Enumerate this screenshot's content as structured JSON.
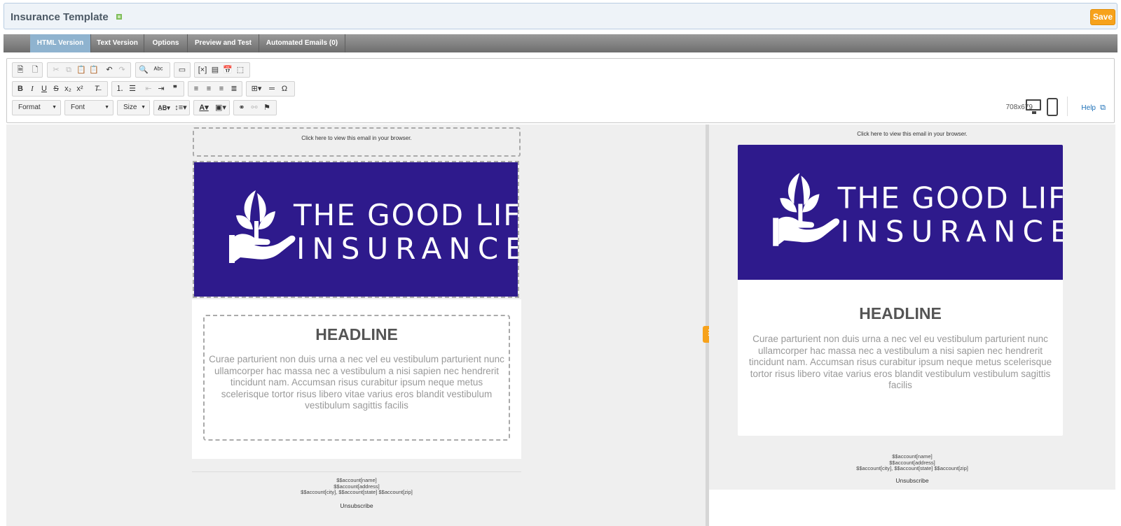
{
  "header": {
    "title": "Insurance Template",
    "save_label": "Save"
  },
  "tabs": [
    {
      "label": "HTML Version",
      "active": true
    },
    {
      "label": "Text Version"
    },
    {
      "label": "Options"
    },
    {
      "label": "Preview and Test"
    },
    {
      "label": "Automated Emails (0)"
    }
  ],
  "toolbar": {
    "format_label": "Format",
    "font_label": "Font",
    "size_label": "Size",
    "dimensions": "708x679",
    "help_label": "Help"
  },
  "email": {
    "view_in_browser": "Click here to view this email in your browser.",
    "brand_line1": "THE GOOD LIFE",
    "brand_line2": "INSURANCE",
    "headline": "HEADLINE",
    "body": "Curae parturient non duis urna a nec vel eu vestibulum parturient nunc ullamcorper hac massa nec a vestibulum a nisi sapien nec hendrerit tincidunt nam. Accumsan risus curabitur ipsum neque metus scelerisque tortor risus libero vitae varius eros blandit vestibulum vestibulum sagittis facilis",
    "footer": {
      "line1": "$$account[name]",
      "line2": "$$account[address]",
      "line3": "$$account[city], $$account[state] $$account[zip]",
      "unsubscribe": "Unsubscribe"
    }
  },
  "colors": {
    "accent": "#f7a21b",
    "banner": "#2e1a8c",
    "active_tab": "#8fb3cf"
  }
}
